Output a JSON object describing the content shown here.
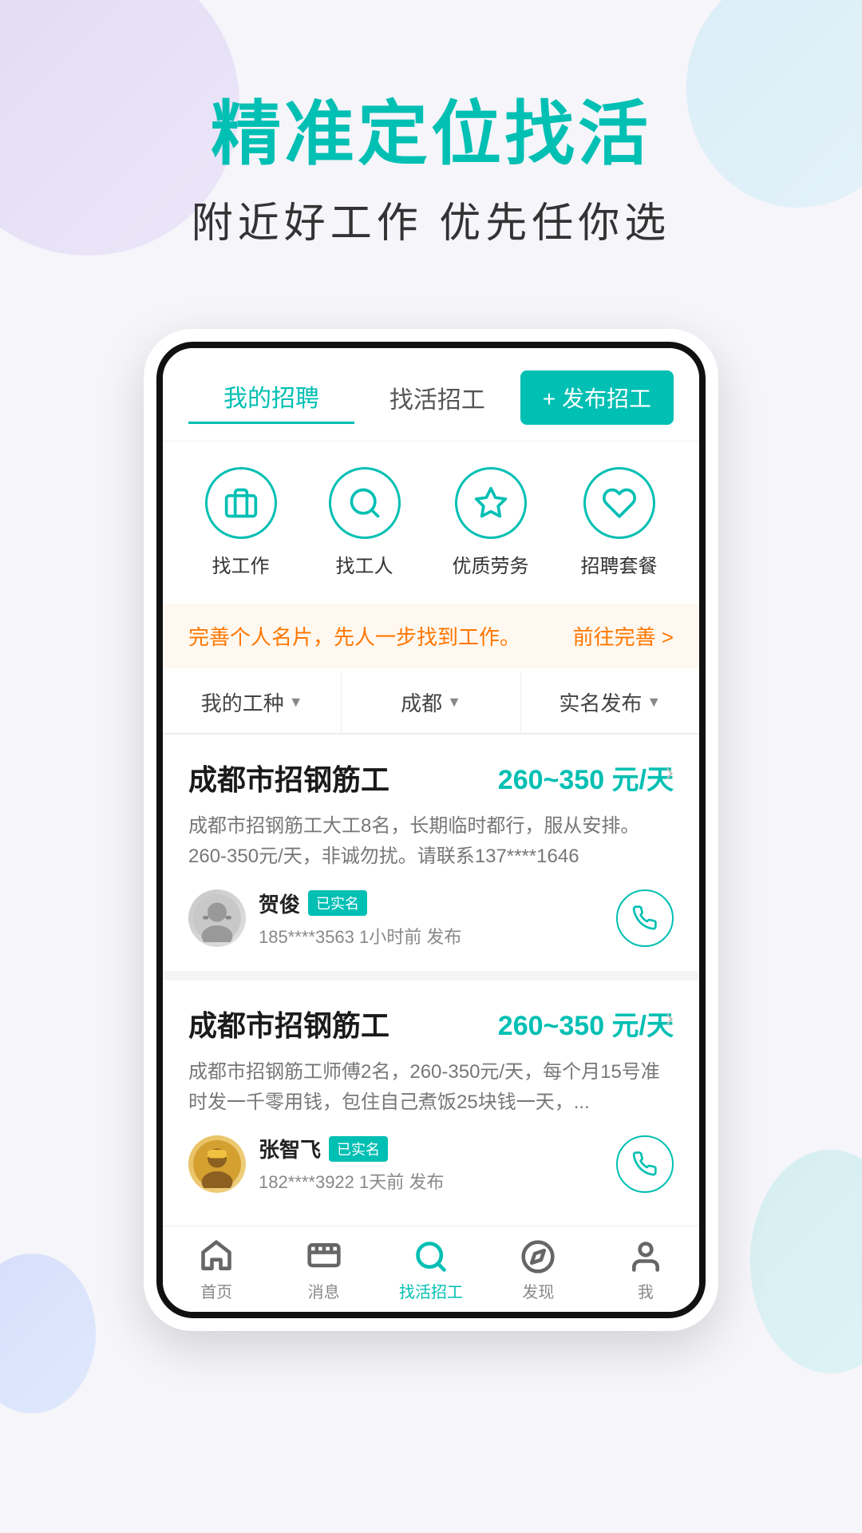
{
  "hero": {
    "title": "精准定位找活",
    "subtitle": "附近好工作  优先任你选"
  },
  "app": {
    "nav": {
      "tab1": "我的招聘",
      "tab2": "找活招工",
      "publish_btn": "+ 发布招工"
    },
    "quick_actions": [
      {
        "label": "找工作",
        "icon": "briefcase"
      },
      {
        "label": "找工人",
        "icon": "search"
      },
      {
        "label": "优质劳务",
        "icon": "star"
      },
      {
        "label": "招聘套餐",
        "icon": "heart"
      }
    ],
    "banner": {
      "text": "完善个人名片，先人一步找到工作。",
      "link": "前往完善 >"
    },
    "filters": [
      {
        "label": "我的工种",
        "arrow": "▼"
      },
      {
        "label": "成都",
        "arrow": "▼"
      },
      {
        "label": "实名发布",
        "arrow": "▼"
      }
    ],
    "jobs": [
      {
        "title": "成都市招钢筋工",
        "salary": "260~350 元/天",
        "desc": "成都市招钢筋工大工8名，长期临时都行，服从安排。260-350元/天，非诚勿扰。请联系137****1646",
        "poster_name": "贺俊",
        "verified": "已实名",
        "phone": "185****3563",
        "time": "1小时前 发布",
        "avatar_type": "1"
      },
      {
        "title": "成都市招钢筋工",
        "salary": "260~350 元/天",
        "desc": "成都市招钢筋工师傅2名，260-350元/天，每个月15号准时发一千零用钱，包住自己煮饭25块钱一天，...",
        "poster_name": "张智飞",
        "verified": "已实名",
        "phone": "182****3922",
        "time": "1天前 发布",
        "avatar_type": "2"
      }
    ],
    "bottom_nav": [
      {
        "label": "首页",
        "icon": "home",
        "active": false
      },
      {
        "label": "消息",
        "icon": "message",
        "active": false
      },
      {
        "label": "找活招工",
        "icon": "search",
        "active": true
      },
      {
        "label": "发现",
        "icon": "compass",
        "active": false
      },
      {
        "label": "我",
        "icon": "user",
        "active": false
      }
    ]
  }
}
